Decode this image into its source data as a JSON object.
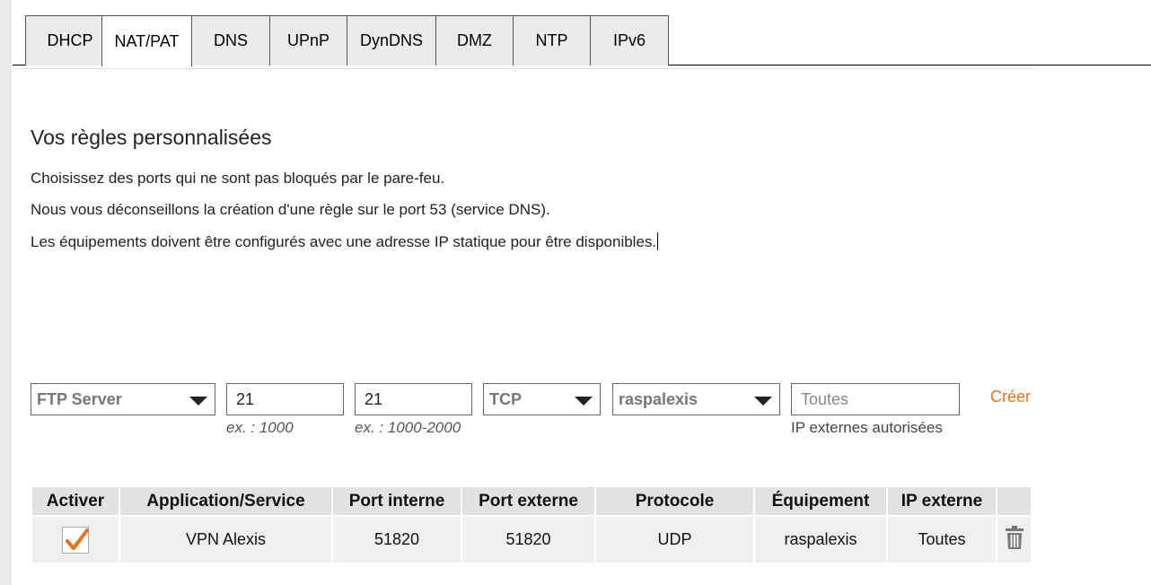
{
  "tabs": [
    {
      "label": "DHCP"
    },
    {
      "label": "NAT/PAT"
    },
    {
      "label": "DNS"
    },
    {
      "label": "UPnP"
    },
    {
      "label": "DynDNS"
    },
    {
      "label": "DMZ"
    },
    {
      "label": "NTP"
    },
    {
      "label": "IPv6"
    }
  ],
  "active_tab": "NAT/PAT",
  "section": {
    "title": "Vos règles personnalisées",
    "lines": [
      "Choisissez des ports qui ne sont pas bloqués par le pare-feu.",
      "Nous vous déconseillons la création d'une règle sur le port 53 (service DNS).",
      "Les équipements doivent être configurés avec une adresse IP statique pour être disponibles."
    ]
  },
  "form": {
    "application": "FTP Server",
    "internal_port": "21",
    "internal_port_hint": "ex. : 1000",
    "external_port": "21",
    "external_port_hint": "ex. : 1000-2000",
    "protocol": "TCP",
    "device": "raspalexis",
    "external_ip_placeholder": "Toutes",
    "external_ip_hint": "IP externes autorisées",
    "create_label": "Créer"
  },
  "table": {
    "headers": [
      "Activer",
      "Application/Service",
      "Port interne",
      "Port externe",
      "Protocole",
      "Équipement",
      "IP externe",
      ""
    ],
    "rows": [
      {
        "active": true,
        "application": "VPN Alexis",
        "internal_port": "51820",
        "external_port": "51820",
        "protocol": "UDP",
        "device": "raspalexis",
        "external_ip": "Toutes"
      }
    ]
  },
  "colors": {
    "accent": "#e4751a",
    "tab_inactive": "#ebebeb",
    "header_bg": "#e2e2e2",
    "row_bg": "#efefef"
  }
}
